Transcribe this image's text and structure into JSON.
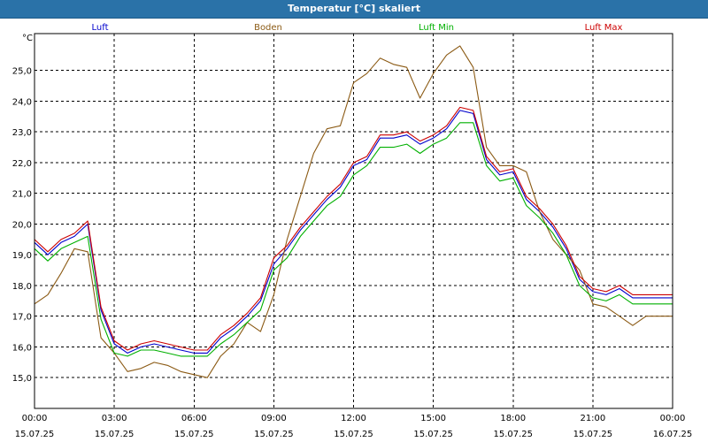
{
  "window": {
    "title": "Temperatur [°C] skaliert"
  },
  "chart_data": {
    "type": "line",
    "title": "Temperatur [°C] skaliert",
    "ylabel": "°C",
    "xlabel": "",
    "ylim": [
      14.0,
      26.2
    ],
    "xlim": [
      0,
      24
    ],
    "grid": true,
    "legend_placement": "top",
    "y_ticks": [
      "15,0",
      "16,0",
      "17,0",
      "18,0",
      "19,0",
      "20,0",
      "21,0",
      "22,0",
      "23,0",
      "24,0",
      "25,0"
    ],
    "x_ticks": [
      {
        "time": "00:00",
        "date": "15.07.25"
      },
      {
        "time": "03:00",
        "date": "15.07.25"
      },
      {
        "time": "06:00",
        "date": "15.07.25"
      },
      {
        "time": "09:00",
        "date": "15.07.25"
      },
      {
        "time": "12:00",
        "date": "15.07.25"
      },
      {
        "time": "15:00",
        "date": "15.07.25"
      },
      {
        "time": "18:00",
        "date": "15.07.25"
      },
      {
        "time": "21:00",
        "date": "15.07.25"
      },
      {
        "time": "00:00",
        "date": "16.07.25"
      }
    ],
    "x_hours": [
      0,
      0.5,
      1,
      1.5,
      2,
      2.5,
      3,
      3.5,
      4,
      4.5,
      5,
      5.5,
      6,
      6.5,
      7,
      7.5,
      8,
      8.5,
      9,
      9.5,
      10,
      10.5,
      11,
      11.5,
      12,
      12.5,
      13,
      13.5,
      14,
      14.5,
      15,
      15.5,
      16,
      16.5,
      17,
      17.5,
      18,
      18.5,
      19,
      19.5,
      20,
      20.5,
      21,
      21.5,
      22,
      22.5,
      23,
      23.5,
      24
    ],
    "series": [
      {
        "name": "Luft",
        "color": "#0000cc",
        "values": [
          19.4,
          19.0,
          19.4,
          19.6,
          20.0,
          17.2,
          16.1,
          15.8,
          16.0,
          16.1,
          16.0,
          15.9,
          15.8,
          15.8,
          16.3,
          16.6,
          17.0,
          17.5,
          18.7,
          19.2,
          19.8,
          20.3,
          20.8,
          21.2,
          21.9,
          22.1,
          22.8,
          22.8,
          22.9,
          22.6,
          22.8,
          23.1,
          23.7,
          23.6,
          22.1,
          21.6,
          21.7,
          20.8,
          20.4,
          19.9,
          19.2,
          18.2,
          17.8,
          17.7,
          17.9,
          17.6,
          17.6,
          17.6,
          17.6
        ]
      },
      {
        "name": "Boden",
        "color": "#8b5a14",
        "values": [
          17.4,
          17.7,
          18.4,
          19.2,
          19.1,
          16.3,
          15.8,
          15.2,
          15.3,
          15.5,
          15.4,
          15.2,
          15.1,
          15.0,
          15.7,
          16.1,
          16.8,
          16.5,
          17.7,
          19.5,
          20.9,
          22.3,
          23.1,
          23.2,
          24.6,
          24.9,
          25.4,
          25.2,
          25.1,
          24.1,
          24.9,
          25.5,
          25.8,
          25.1,
          22.5,
          21.9,
          21.9,
          21.7,
          20.4,
          19.5,
          19.0,
          18.5,
          17.4,
          17.3,
          17.0,
          16.7,
          17.0,
          17.0,
          17.0
        ]
      },
      {
        "name": "Luft Min",
        "color": "#00b000",
        "values": [
          19.2,
          18.8,
          19.2,
          19.4,
          19.6,
          16.9,
          15.8,
          15.7,
          15.9,
          15.9,
          15.8,
          15.7,
          15.7,
          15.7,
          16.1,
          16.4,
          16.8,
          17.2,
          18.5,
          18.9,
          19.6,
          20.1,
          20.6,
          20.9,
          21.6,
          21.9,
          22.5,
          22.5,
          22.6,
          22.3,
          22.6,
          22.8,
          23.3,
          23.3,
          21.9,
          21.4,
          21.5,
          20.6,
          20.2,
          19.7,
          19.0,
          18.0,
          17.6,
          17.5,
          17.7,
          17.4,
          17.4,
          17.4,
          17.4
        ]
      },
      {
        "name": "Luft Max",
        "color": "#cc0000",
        "values": [
          19.5,
          19.1,
          19.5,
          19.7,
          20.1,
          17.3,
          16.2,
          15.9,
          16.1,
          16.2,
          16.1,
          16.0,
          15.9,
          15.9,
          16.4,
          16.7,
          17.1,
          17.6,
          18.9,
          19.3,
          19.9,
          20.4,
          20.9,
          21.3,
          22.0,
          22.2,
          22.9,
          22.9,
          23.0,
          22.7,
          22.9,
          23.2,
          23.8,
          23.7,
          22.2,
          21.7,
          21.8,
          20.9,
          20.5,
          20.0,
          19.3,
          18.3,
          17.9,
          17.8,
          18.0,
          17.7,
          17.7,
          17.7,
          17.7
        ]
      }
    ]
  }
}
